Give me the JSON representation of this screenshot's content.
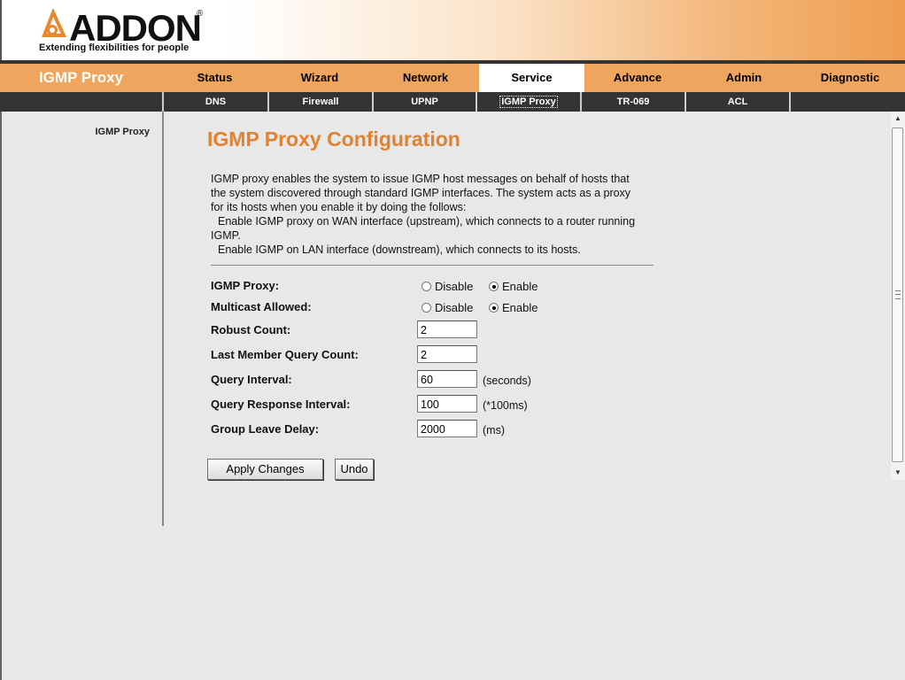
{
  "brand": {
    "name": "ADDON",
    "registered_mark": "®",
    "tagline": "Extending flexibilities for people",
    "accent_color": "#e0822e"
  },
  "mainnav": {
    "section_title": "IGMP Proxy",
    "tabs": [
      {
        "label": "Status",
        "active": false
      },
      {
        "label": "Wizard",
        "active": false
      },
      {
        "label": "Network",
        "active": false
      },
      {
        "label": "Service",
        "active": true
      },
      {
        "label": "Advance",
        "active": false
      },
      {
        "label": "Admin",
        "active": false
      },
      {
        "label": "Diagnostic",
        "active": false
      }
    ]
  },
  "subnav": {
    "tabs": [
      {
        "label": "DNS",
        "active": false
      },
      {
        "label": "Firewall",
        "active": false
      },
      {
        "label": "UPNP",
        "active": false
      },
      {
        "label": "IGMP Proxy",
        "active": true
      },
      {
        "label": "TR-069",
        "active": false
      },
      {
        "label": "ACL",
        "active": false
      }
    ]
  },
  "sidebar": {
    "item": "IGMP Proxy"
  },
  "main": {
    "title": "IGMP Proxy Configuration",
    "description": [
      "IGMP proxy enables the system to issue IGMP host messages on behalf of hosts that",
      "the system discovered through standard IGMP interfaces. The system acts as a proxy",
      "for its hosts when you enable it by doing the follows:",
      "Enable IGMP proxy on WAN interface (upstream), which connects to a router running",
      "IGMP.",
      "Enable IGMP on LAN interface (downstream), which connects to its hosts."
    ],
    "igmp_proxy": {
      "label": "IGMP Proxy:",
      "options": [
        "Disable",
        "Enable"
      ],
      "selected": "Enable"
    },
    "multicast_allowed": {
      "label": "Multicast Allowed:",
      "options": [
        "Disable",
        "Enable"
      ],
      "selected": "Enable"
    },
    "robust_count": {
      "label": "Robust Count:",
      "value": "2"
    },
    "last_member_query_count": {
      "label": "Last Member Query Count:",
      "value": "2"
    },
    "query_interval": {
      "label": "Query Interval:",
      "value": "60",
      "unit": "(seconds)"
    },
    "query_response_interval": {
      "label": "Query Response Interval:",
      "value": "100",
      "unit": "(*100ms)"
    },
    "group_leave_delay": {
      "label": "Group Leave Delay:",
      "value": "2000",
      "unit": "(ms)"
    },
    "buttons": {
      "apply": "Apply Changes",
      "undo": "Undo"
    }
  },
  "scrollbar": {
    "up_arrow": "▲",
    "down_arrow": "▼"
  }
}
